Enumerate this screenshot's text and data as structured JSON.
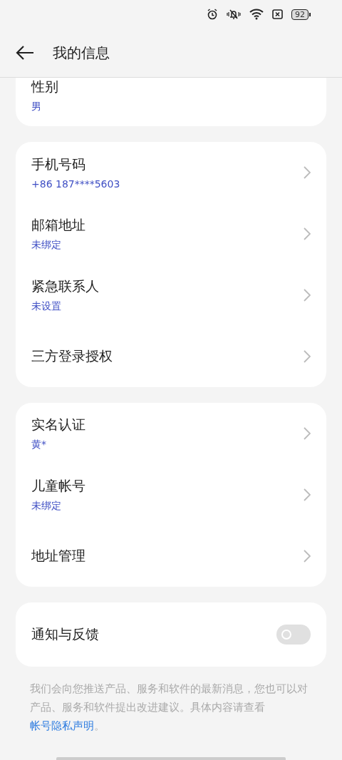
{
  "header": {
    "title": "我的信息"
  },
  "groups": [
    {
      "partial": true,
      "items": [
        {
          "kind": "info",
          "label": "性别",
          "value": "男"
        }
      ]
    },
    {
      "partial": false,
      "items": [
        {
          "kind": "nav",
          "label": "手机号码",
          "value": "+86 187****5603"
        },
        {
          "kind": "nav",
          "label": "邮箱地址",
          "value": "未绑定"
        },
        {
          "kind": "nav",
          "label": "紧急联系人",
          "value": "未设置"
        },
        {
          "kind": "nav",
          "label": "三方登录授权"
        }
      ]
    },
    {
      "partial": false,
      "items": [
        {
          "kind": "nav",
          "label": "实名认证",
          "value": "黄*"
        },
        {
          "kind": "nav",
          "label": "儿童帐号",
          "value": "未绑定"
        },
        {
          "kind": "nav",
          "label": "地址管理"
        }
      ]
    },
    {
      "partial": false,
      "items": [
        {
          "kind": "toggle",
          "label": "通知与反馈",
          "on": false
        }
      ]
    }
  ],
  "footnote": {
    "text": "我们会向您推送产品、服务和软件的最新消息，您也可以对产品、服务和软件提出改进建议。具体内容请查看 ",
    "link": "帐号隐私声明",
    "end": "。"
  },
  "status_bar": {
    "battery": "92"
  }
}
